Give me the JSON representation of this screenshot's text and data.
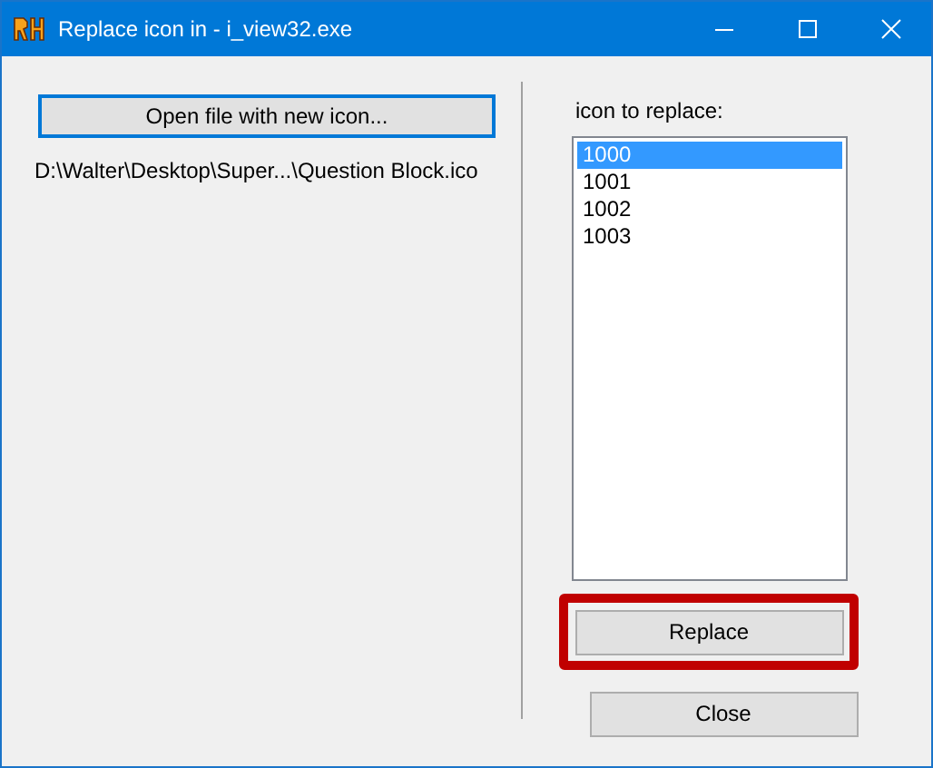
{
  "window": {
    "title": "Replace icon in - i_view32.exe"
  },
  "open_button": {
    "label": "Open file with new icon...",
    "focused": true
  },
  "file_path": "D:\\Walter\\Desktop\\Super...\\Question Block.ico",
  "icon_list": {
    "label": "icon to replace:",
    "items": [
      {
        "label": "1000",
        "selected": true
      },
      {
        "label": "1001",
        "selected": false
      },
      {
        "label": "1002",
        "selected": false
      },
      {
        "label": "1003",
        "selected": false
      }
    ]
  },
  "buttons": [
    {
      "label": "Replace",
      "highlighted": true
    },
    {
      "label": "Close",
      "highlighted": false
    }
  ]
}
